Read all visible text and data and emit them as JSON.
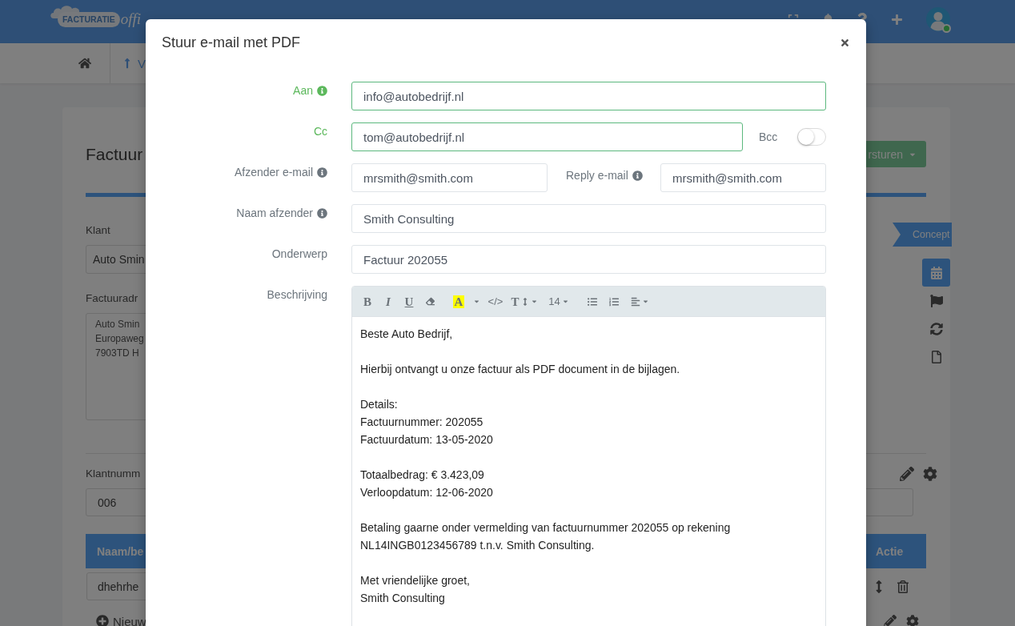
{
  "header": {
    "logo": {
      "badge": "FACTURATIE",
      "script": "offi"
    },
    "actions": [
      {
        "kind": "expand"
      },
      {
        "kind": "bell"
      },
      {
        "kind": "help"
      },
      {
        "kind": "add"
      },
      {
        "kind": "avatar",
        "online": true
      }
    ]
  },
  "nav": [
    {
      "kind": "home"
    },
    {
      "kind": "up",
      "label": "V"
    }
  ],
  "invoice": {
    "title": "Factuur",
    "send_button": "rsturen",
    "status": "Concept",
    "side_actions": [
      {
        "kind": "calendar",
        "selected": true
      },
      {
        "kind": "flag",
        "selected": false
      },
      {
        "kind": "refresh",
        "selected": false
      },
      {
        "kind": "file",
        "selected": false
      }
    ],
    "customer": {
      "label": "Klant",
      "value": "Auto Smin"
    },
    "address": {
      "label": "Factuuradr",
      "lines": [
        "Auto Smin",
        "Europaweg",
        "7903TD H"
      ]
    },
    "customer_number": {
      "label": "Klantnumm",
      "value": "006"
    },
    "table": {
      "columns": [
        "Naam/be",
        "Actie"
      ],
      "rows": [
        {
          "name": "dhehrhe"
        }
      ]
    },
    "add_line": "Nieuw"
  },
  "modal": {
    "title": "Stuur e-mail met PDF",
    "rows": [
      {
        "kind": "single",
        "label": "Aan",
        "info": true,
        "valid": true,
        "value": "info@autobedrijf.nl"
      },
      {
        "kind": "toggle",
        "label": "Cc",
        "info": false,
        "valid": true,
        "value": "tom@autobedrijf.nl",
        "toggle": {
          "label": "Bcc",
          "on": false
        }
      },
      {
        "kind": "pair",
        "label": "Afzender e-mail",
        "info": true,
        "valid": false,
        "value": "mrsmith@smith.com",
        "second": {
          "label": "Reply e-mail",
          "info": true,
          "value": "mrsmith@smith.com"
        }
      },
      {
        "kind": "single",
        "label": "Naam afzender",
        "info": true,
        "valid": false,
        "value": "Smith Consulting"
      },
      {
        "kind": "single",
        "label": "Onderwerp",
        "info": false,
        "valid": false,
        "value": "Factuur 202055"
      },
      {
        "kind": "editor",
        "label": "Beschrijving",
        "info": false,
        "valid": false,
        "toolbar": [
          {
            "kind": "bold",
            "label": "B"
          },
          {
            "kind": "italic",
            "label": "I"
          },
          {
            "kind": "underline",
            "label": "U"
          },
          {
            "kind": "eraser"
          },
          {
            "kind": "highlight",
            "label": "A"
          },
          {
            "kind": "caret"
          },
          {
            "kind": "code",
            "label": "</>"
          },
          {
            "kind": "text-height",
            "label": "T",
            "dropdown": true
          },
          {
            "kind": "font-size",
            "label": "14",
            "dropdown": true
          },
          {
            "kind": "bullet-list"
          },
          {
            "kind": "numbered-list"
          },
          {
            "kind": "align",
            "dropdown": true
          }
        ],
        "paragraphs": [
          [
            "Beste Auto Bedrijf,"
          ],
          [
            "Hierbij ontvangt u onze factuur als PDF document in de bijlagen."
          ],
          [
            "Details:",
            "Factuurnummer: 202055",
            "Factuurdatum: 13-05-2020"
          ],
          [
            "Totaalbedrag: € 3.423,09",
            "Verloopdatum: 12-06-2020"
          ],
          [
            "Betaling gaarne onder vermelding van factuurnummer 202055 op rekening NL14INGB0123456789 t.n.v. Smith Consulting."
          ],
          [
            "Met vriendelijke groet,",
            "Smith Consulting"
          ]
        ]
      }
    ]
  }
}
